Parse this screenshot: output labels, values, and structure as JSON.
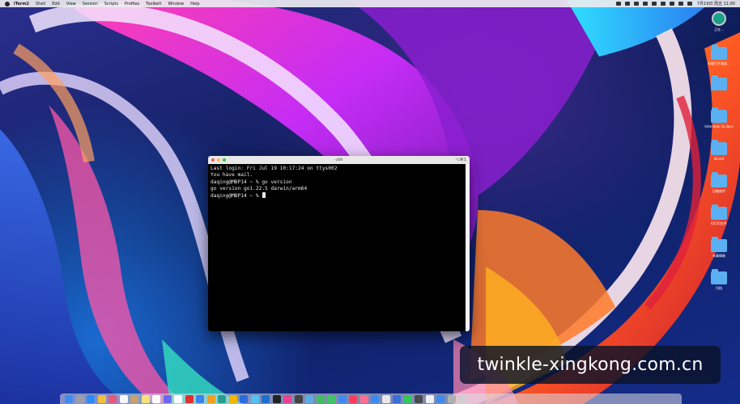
{
  "menubar": {
    "app_name": "iTerm2",
    "menus": [
      "Shell",
      "Edit",
      "View",
      "Session",
      "Scripts",
      "Profiles",
      "Toolbelt",
      "Window",
      "Help"
    ],
    "clock": "7月19日 周五 11:00"
  },
  "desktop": {
    "items": [
      {
        "icon": "time-machine-icon",
        "label": "正在..."
      },
      {
        "icon": "folder-icon",
        "label": "未能打开服务..."
      },
      {
        "icon": "folder-icon",
        "label": ""
      },
      {
        "icon": "folder-icon",
        "label": "Interview 3x docs"
      },
      {
        "icon": "folder-icon",
        "label": "dicord"
      },
      {
        "icon": "folder-icon",
        "label": "压缩软件"
      },
      {
        "icon": "folder-icon",
        "label": "6月30文件"
      },
      {
        "icon": "folder-icon",
        "label": "有事情做"
      },
      {
        "icon": "folder-icon",
        "label": "归档"
      }
    ]
  },
  "terminal": {
    "title": "-zsh",
    "shortcut": "⌥⌘1",
    "lines": [
      "Last login: Fri Jul 19 10:17:24 on ttys002",
      "You have mail.",
      "daqing@MBP14 ~ % go version",
      "go version go1.22.5 darwin/arm64"
    ],
    "prompt": "daqing@MBP14 ~ % "
  },
  "dock": {
    "apps": [
      {
        "name": "finder-icon",
        "color": "#3d8bf0"
      },
      {
        "name": "launchpad-icon",
        "color": "#9aa0a8"
      },
      {
        "name": "app-store-icon",
        "color": "#2b8cf5"
      },
      {
        "name": "mail-icon",
        "color": "#f0c040"
      },
      {
        "name": "photos-icon",
        "color": "#e85a7a"
      },
      {
        "name": "calendar-icon",
        "color": "#f7f7f7"
      },
      {
        "name": "contacts-icon",
        "color": "#c9a070"
      },
      {
        "name": "notes-icon",
        "color": "#f6e27a"
      },
      {
        "name": "reminders-icon",
        "color": "#ffffff"
      },
      {
        "name": "app-icon-1",
        "color": "#6a6af0"
      },
      {
        "name": "app-icon-2",
        "color": "#ffffff"
      },
      {
        "name": "app-icon-3",
        "color": "#e03030"
      },
      {
        "name": "app-icon-4",
        "color": "#3c82f0"
      },
      {
        "name": "app-icon-5",
        "color": "#f0a020"
      },
      {
        "name": "app-icon-6",
        "color": "#2a9d8f"
      },
      {
        "name": "chrome-icon",
        "color": "#f2b705"
      },
      {
        "name": "app-icon-7",
        "color": "#2d6cdf"
      },
      {
        "name": "app-icon-8",
        "color": "#56c0f0"
      },
      {
        "name": "app-icon-9",
        "color": "#1f6fd0"
      },
      {
        "name": "terminal-icon",
        "color": "#222222"
      },
      {
        "name": "app-icon-10",
        "color": "#e84393"
      },
      {
        "name": "app-icon-11",
        "color": "#444444"
      },
      {
        "name": "app-icon-12",
        "color": "#5dade2"
      },
      {
        "name": "wechat-icon",
        "color": "#3fbf5f"
      },
      {
        "name": "messages-icon",
        "color": "#3cc860"
      },
      {
        "name": "app-icon-13",
        "color": "#3d8bf0"
      },
      {
        "name": "music-icon",
        "color": "#fa3d5a"
      },
      {
        "name": "app-icon-14",
        "color": "#ff6f91"
      },
      {
        "name": "app-icon-15",
        "color": "#3d8bf0"
      },
      {
        "name": "app-icon-16",
        "color": "#e8e8e8"
      },
      {
        "name": "app-icon-17",
        "color": "#3a6fd8"
      },
      {
        "name": "facetime-icon",
        "color": "#34c759"
      },
      {
        "name": "app-icon-18",
        "color": "#4a4a4a"
      },
      {
        "name": "app-icon-19",
        "color": "#f0f0f0"
      },
      {
        "name": "app-icon-20",
        "color": "#3d8bf0"
      },
      {
        "name": "app-icon-21",
        "color": "#b0b0b0"
      },
      {
        "name": "trash-icon",
        "color": "#cfcfcf"
      }
    ]
  },
  "watermark": {
    "text": "twinkle-xingkong.com.cn"
  }
}
